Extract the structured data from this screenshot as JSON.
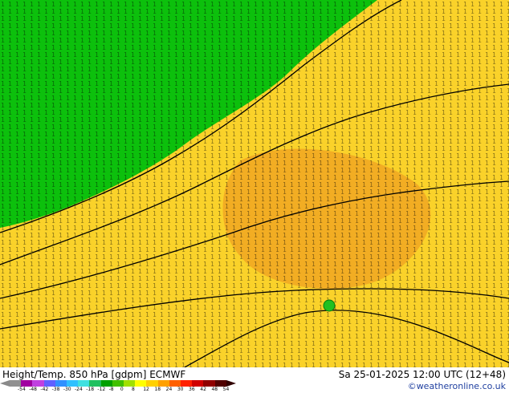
{
  "map": {
    "colors": {
      "cold_green": "#0cc00c",
      "warm_yellow": "#fad22a",
      "warm_orange": "#f0a722",
      "contour": "#000000"
    },
    "marker_icon": "green-location-marker"
  },
  "footer": {
    "title": "Height/Temp. 850 hPa [gdpm] ECMWF",
    "datetime": "Sa 25-01-2025 12:00 UTC (12+48)",
    "credit": "©weatheronline.co.uk"
  },
  "legend": {
    "ticks": [
      "-54",
      "-48",
      "-42",
      "-38",
      "-30",
      "-24",
      "-18",
      "-12",
      "-8",
      "0",
      "8",
      "12",
      "18",
      "24",
      "30",
      "36",
      "42",
      "48",
      "54"
    ],
    "colors": [
      "#909090",
      "#a000a0",
      "#c040e0",
      "#6060ff",
      "#3090ff",
      "#30c0ff",
      "#40e0e0",
      "#20c060",
      "#00a000",
      "#40c000",
      "#a0e000",
      "#ffff00",
      "#ffd000",
      "#ffa000",
      "#ff6000",
      "#ff2000",
      "#d00000",
      "#900000",
      "#500000"
    ]
  }
}
